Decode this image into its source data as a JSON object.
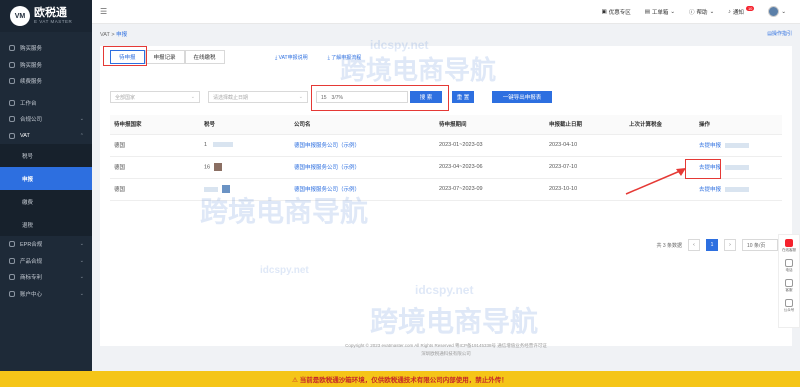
{
  "logo": {
    "mark": "VM",
    "name": "欧税通",
    "sub": "E VAT MASTER"
  },
  "sidebar": {
    "items": [
      {
        "label": "购买服务"
      },
      {
        "label": "购买服务"
      },
      {
        "label": "续费服务"
      },
      {
        "label": "工作台"
      },
      {
        "label": "合规公司"
      },
      {
        "label": "VAT"
      }
    ],
    "sub_items": [
      {
        "label": "税号"
      },
      {
        "label": "申报"
      },
      {
        "label": "缴费"
      },
      {
        "label": "退税"
      }
    ],
    "bottom_items": [
      {
        "label": "EPR合规"
      },
      {
        "label": "产品合规"
      },
      {
        "label": "商标专利"
      },
      {
        "label": "账户中心"
      }
    ]
  },
  "header": {
    "offer": "优惠专区",
    "orders": "工单箱",
    "help": "帮助",
    "messages": "通知",
    "msg_count": "10"
  },
  "breadcrumb": {
    "root": "VAT",
    "sep": ">",
    "current": "申报"
  },
  "guide_link": "操作指引",
  "tabs": [
    {
      "label": "待申报"
    },
    {
      "label": "申报记录"
    },
    {
      "label": "在线缴税"
    }
  ],
  "links": {
    "a": "VAT申报说明",
    "b": "了解申报流程"
  },
  "filters": {
    "country_placeholder": "全部国家",
    "period_placeholder": "请选择截止日期",
    "search_value": "15　3/7%",
    "search_btn": "搜 索",
    "reset_btn": "重 置",
    "export_btn": "一键导出申报表"
  },
  "table": {
    "headers": [
      "待申报国家",
      "税号",
      "公司名",
      "待申报期间",
      "申报截止日期",
      "上次计算税金",
      "操作"
    ],
    "rows": [
      {
        "country": "德国",
        "tax": "1",
        "company": "德国申报服务公司（示例）",
        "period": "2023-01~2023-03",
        "deadline": "2023-04-10",
        "last": "",
        "op": "去提申报"
      },
      {
        "country": "德国",
        "tax": "16",
        "company": "德国申报服务公司（示例）",
        "period": "2023-04~2023-06",
        "deadline": "2023-07-10",
        "last": "",
        "op": "去提申报"
      },
      {
        "country": "德国",
        "tax": "",
        "company": "德国申报服务公司（示例）",
        "period": "2023-07~2023-09",
        "deadline": "2023-10-10",
        "last": "",
        "op": "去提申报"
      }
    ]
  },
  "pager": {
    "total": "共 3 条数据",
    "page": "1",
    "size": "10 条/页"
  },
  "footer": {
    "line1": "Copyright © 2023 evatmaster.com All Rights Reserved   粤ICP备19145338号   通信增值业务经营许可证",
    "line2": "深圳欧税通科技有限公司"
  },
  "floater": [
    "在线客服",
    "电话",
    "客服",
    "公众号"
  ],
  "warning": "⚠ 当前是欧税通沙箱环境，仅供欧税通技术有限公司内部使用，禁止外传！",
  "watermarks": [
    "跨境电商导航",
    "idcspy.net"
  ]
}
